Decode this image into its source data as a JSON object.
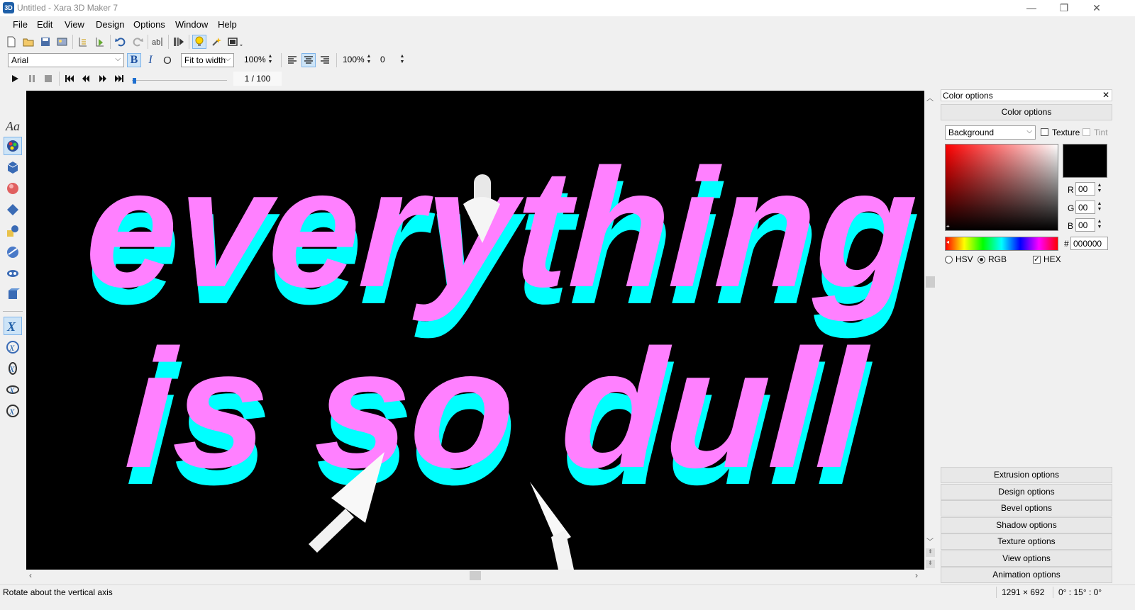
{
  "window": {
    "icon_text": "3D",
    "title": "Untitled - Xara 3D Maker 7",
    "minimize_glyph": "—",
    "restore_glyph": "❐",
    "close_glyph": "✕"
  },
  "menu": [
    "File",
    "Edit",
    "View",
    "Design",
    "Options",
    "Window",
    "Help"
  ],
  "text_toolbar": {
    "font": "Arial",
    "bold": "B",
    "italic": "I",
    "outline": "O",
    "fit_mode": "Fit to width",
    "size_percent": "100%",
    "line_spacing_percent": "100%",
    "letter_spacing": "0"
  },
  "animation_toolbar": {
    "frame_counter": "1 / 100",
    "progress_fraction": 0.01
  },
  "canvas": {
    "line1": "everything",
    "line2": "is so dull",
    "background": "#000000",
    "text_face_color": "#ff80ff",
    "text_extrusion_color": "#00ffff"
  },
  "color_panel": {
    "title": "Color options",
    "header": "Color options",
    "target": "Background",
    "texture_label": "Texture",
    "tint_label": "Tint",
    "r_label": "R",
    "r_value": "00",
    "g_label": "G",
    "g_value": "00",
    "b_label": "B",
    "b_value": "00",
    "hex_prefix": "#",
    "hex_value": "000000",
    "hsv_label": "HSV",
    "rgb_label": "RGB",
    "hex_label": "HEX",
    "swatch_color": "#000000"
  },
  "option_buttons": [
    "Extrusion options",
    "Design options",
    "Bevel options",
    "Shadow options",
    "Texture options",
    "View options",
    "Animation options"
  ],
  "status": {
    "hint": "Rotate about the vertical axis",
    "dimensions": "1291 × 692",
    "rotation": "0° : 15° : 0°"
  }
}
